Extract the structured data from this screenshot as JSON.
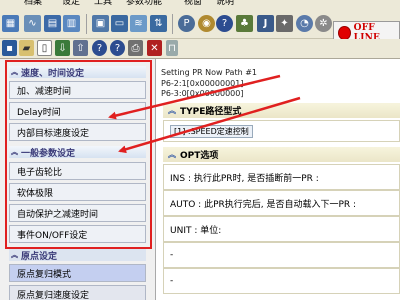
{
  "menu": [
    "档案",
    "设定",
    "工具",
    "参数功能",
    "视窗",
    "说明"
  ],
  "status": {
    "offline_label": "OFF LINE"
  },
  "left_panel": {
    "group1_header": "速度、时间设定",
    "group1_items": [
      "加、减速时间",
      "Delay时间",
      "内部目标速度设定"
    ],
    "group2_header": "一般参数设定",
    "group2_items": [
      "电子齿轮比",
      "软体极限",
      "自动保护之减速时间",
      "事件ON/OFF设定"
    ],
    "group3_header": "原点设定",
    "group3_items": [
      "原点复归模式",
      "原点复归速度设定"
    ]
  },
  "right_panel": {
    "caption_lines": [
      "Setting PR Now Path #1",
      "P6-2:1[0x00000001]",
      "P6-3:0[0x00000000]"
    ],
    "type_header": "TYPE路径型式",
    "type_value": "[1] :SPEED定速控制",
    "opt_header": "OPT选项",
    "opt_rows": [
      "INS : 执行此PR时, 是否插断前一PR :",
      "AUTO : 此PR执行完后, 是否自动载入下一PR :",
      "UNIT : 单位:",
      "-",
      "-"
    ]
  },
  "colors": {
    "annotation_red": "#e02020",
    "offline_red": "#d00000"
  }
}
